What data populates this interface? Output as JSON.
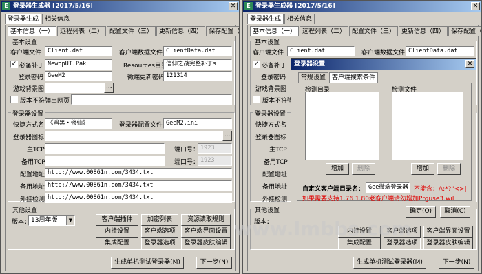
{
  "windows": [
    {
      "title": "登录器生成器 [2017/5/16]",
      "top_tabs": [
        "登录器生成",
        "相关信息"
      ],
      "sub_tabs": [
        "基本信息（一）",
        "远程列表（二）",
        "配置文件（三）",
        "更新信息（四）",
        "保存配置（五）"
      ],
      "basic": {
        "group": "基本设置",
        "client_file_label": "客户端文件",
        "client_file": "Client.dat",
        "client_data_label": "客户端数据文件",
        "client_data": "ClientData.dat",
        "patch_label": "必备补丁",
        "patch": "NewopUI.Pak",
        "resources_label": "Resources目录",
        "resources": "信仰之战完整补丁s",
        "password_label": "登录密码",
        "password": "GeeM2",
        "micro_pwd_label": "微端更新密码",
        "micro_pwd": "121314",
        "bg_label": "游戏背景图",
        "bg": "",
        "browse": "...",
        "version_label": "版本不符弹出网页"
      },
      "launcher": {
        "group": "登录器设置",
        "shortcut_label": "快捷方式名",
        "shortcut": "《暗黑・修仙》",
        "config_label": "登录器配置文件",
        "config": "GeeM2.ini",
        "icon_label": "登录器图标",
        "main_tcp_label": "主TCP",
        "backup_tcp_label": "备用TCP",
        "port_label": "端口号：",
        "port": "1923",
        "config_url_label": "配置地址",
        "config_url": "http://www.00861n.com/3434.txt",
        "backup_url_label": "备用地址",
        "backup_url": "http://www.00861n.com/3434.txt",
        "plugin_label": "外挂检测",
        "plugin_url": "http://www.00861n.com/3434.txt"
      },
      "other": {
        "group": "其他设置",
        "version_label": "版本：",
        "version": "13周年版",
        "buttons": [
          "客户端插件",
          "加密列表",
          "资源读取规则",
          "内挂设置",
          "客户端选项",
          "客户端界面设置",
          "集成配置",
          "登录器选项",
          "登录器皮肤编辑"
        ]
      },
      "generate": "生成单机测试登录器(M)",
      "next": "下一步(N)"
    }
  ],
  "dialog": {
    "title": "登录器设置",
    "tabs": [
      "常规设置",
      "客户端搜索条件"
    ],
    "dir_list_label": "检测目录",
    "file_list_label": "检测文件",
    "add": "增加",
    "remove": "删除",
    "custom_dir_label": "自定义客户端目录名：",
    "custom_dir": "Gee微端登录器",
    "warning": "不能含：/\\:*?\"<>|",
    "note": "如果需要支持1.76 1.80老客户端请勿增加Prguse3.wil",
    "ok": "确定(O)",
    "cancel": "取消(C)"
  },
  "watermark": "www.lmbbs.com"
}
